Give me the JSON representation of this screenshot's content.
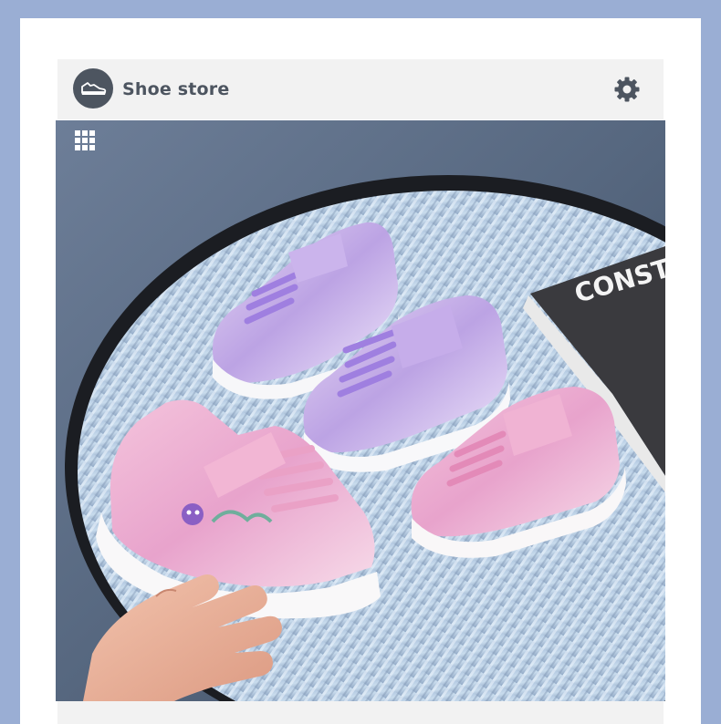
{
  "header": {
    "title": "Shoe store",
    "logo_icon": "sneaker-icon",
    "settings_icon": "gear-icon"
  },
  "photo": {
    "grid_icon": "grid-icon",
    "book_text": "CONST"
  },
  "colors": {
    "page_background": "#9aaed4",
    "card": "#ffffff",
    "header_background": "#f2f2f2",
    "icon_dark": "#4d5560"
  }
}
